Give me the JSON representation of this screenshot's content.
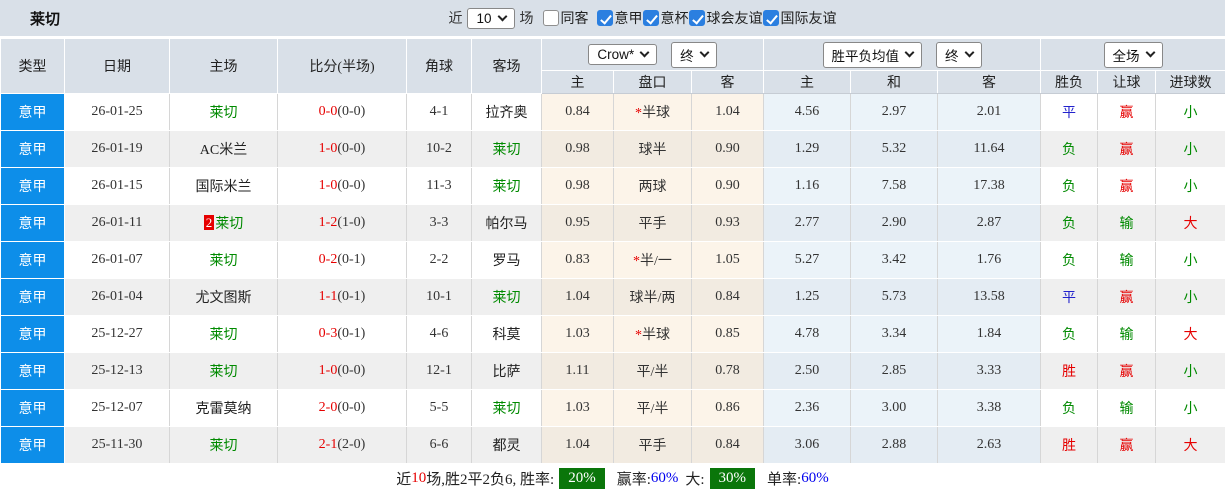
{
  "title": "莱切",
  "topbar": {
    "near_label": "近",
    "matches_value": "10",
    "matches_label": "场",
    "checkboxes": [
      {
        "id": "same-away",
        "label": "同客",
        "checked": false
      },
      {
        "id": "serie-a",
        "label": "意甲",
        "checked": true
      },
      {
        "id": "italy-cup",
        "label": "意杯",
        "checked": true
      },
      {
        "id": "club-friendly",
        "label": "球会友谊",
        "checked": true
      },
      {
        "id": "intl-friendly",
        "label": "国际友谊",
        "checked": true
      }
    ]
  },
  "header": {
    "left_cols": [
      "类型",
      "日期",
      "主场",
      "比分(半场)",
      "角球",
      "客场"
    ],
    "odds_group": {
      "company_select": "Crow*",
      "stage_select": "终",
      "cols": [
        "主",
        "盘口",
        "客"
      ]
    },
    "mean_group": {
      "type_select": "胜平负均值",
      "stage_select": "终",
      "cols": [
        "主",
        "和",
        "客"
      ]
    },
    "result_group": {
      "scope_select": "全场",
      "cols": [
        "胜负",
        "让球",
        "进球数"
      ]
    }
  },
  "rows": [
    {
      "league": "意甲",
      "date": "26-01-25",
      "home": "莱切",
      "home_c": "green",
      "home_badge": "",
      "score": "0-0",
      "half": "(0-0)",
      "corner": "4-1",
      "away": "拉齐奥",
      "away_c": "dark",
      "o_home": "0.84",
      "star": "*",
      "handicap": "半球",
      "o_away": "1.04",
      "m_home": "4.56",
      "m_draw": "2.97",
      "m_away": "2.01",
      "result": {
        "t": "平",
        "c": "blue"
      },
      "hresult": {
        "t": "赢",
        "c": "red"
      },
      "goals": {
        "t": "小",
        "c": "green"
      }
    },
    {
      "league": "意甲",
      "date": "26-01-19",
      "home": "AC米兰",
      "home_c": "dark",
      "home_badge": "",
      "score": "1-0",
      "half": "(0-0)",
      "corner": "10-2",
      "away": "莱切",
      "away_c": "green",
      "o_home": "0.98",
      "star": "",
      "handicap": "球半",
      "o_away": "0.90",
      "m_home": "1.29",
      "m_draw": "5.32",
      "m_away": "11.64",
      "result": {
        "t": "负",
        "c": "green"
      },
      "hresult": {
        "t": "赢",
        "c": "red"
      },
      "goals": {
        "t": "小",
        "c": "green"
      }
    },
    {
      "league": "意甲",
      "date": "26-01-15",
      "home": "国际米兰",
      "home_c": "dark",
      "home_badge": "",
      "score": "1-0",
      "half": "(0-0)",
      "corner": "11-3",
      "away": "莱切",
      "away_c": "green",
      "o_home": "0.98",
      "star": "",
      "handicap": "两球",
      "o_away": "0.90",
      "m_home": "1.16",
      "m_draw": "7.58",
      "m_away": "17.38",
      "result": {
        "t": "负",
        "c": "green"
      },
      "hresult": {
        "t": "赢",
        "c": "red"
      },
      "goals": {
        "t": "小",
        "c": "green"
      }
    },
    {
      "league": "意甲",
      "date": "26-01-11",
      "home": "莱切",
      "home_c": "green",
      "home_badge": "2",
      "score": "1-2",
      "half": "(1-0)",
      "corner": "3-3",
      "away": "帕尔马",
      "away_c": "dark",
      "o_home": "0.95",
      "star": "",
      "handicap": "平手",
      "o_away": "0.93",
      "m_home": "2.77",
      "m_draw": "2.90",
      "m_away": "2.87",
      "result": {
        "t": "负",
        "c": "green"
      },
      "hresult": {
        "t": "输",
        "c": "green"
      },
      "goals": {
        "t": "大",
        "c": "red"
      }
    },
    {
      "league": "意甲",
      "date": "26-01-07",
      "home": "莱切",
      "home_c": "green",
      "home_badge": "",
      "score": "0-2",
      "half": "(0-1)",
      "corner": "2-2",
      "away": "罗马",
      "away_c": "dark",
      "o_home": "0.83",
      "star": "*",
      "handicap": "半/一",
      "o_away": "1.05",
      "m_home": "5.27",
      "m_draw": "3.42",
      "m_away": "1.76",
      "result": {
        "t": "负",
        "c": "green"
      },
      "hresult": {
        "t": "输",
        "c": "green"
      },
      "goals": {
        "t": "小",
        "c": "green"
      }
    },
    {
      "league": "意甲",
      "date": "26-01-04",
      "home": "尤文图斯",
      "home_c": "dark",
      "home_badge": "",
      "score": "1-1",
      "half": "(0-1)",
      "corner": "10-1",
      "away": "莱切",
      "away_c": "green",
      "o_home": "1.04",
      "star": "",
      "handicap": "球半/两",
      "o_away": "0.84",
      "m_home": "1.25",
      "m_draw": "5.73",
      "m_away": "13.58",
      "result": {
        "t": "平",
        "c": "blue"
      },
      "hresult": {
        "t": "赢",
        "c": "red"
      },
      "goals": {
        "t": "小",
        "c": "green"
      }
    },
    {
      "league": "意甲",
      "date": "25-12-27",
      "home": "莱切",
      "home_c": "green",
      "home_badge": "",
      "score": "0-3",
      "half": "(0-1)",
      "corner": "4-6",
      "away": "科莫",
      "away_c": "dark",
      "o_home": "1.03",
      "star": "*",
      "handicap": "半球",
      "o_away": "0.85",
      "m_home": "4.78",
      "m_draw": "3.34",
      "m_away": "1.84",
      "result": {
        "t": "负",
        "c": "green"
      },
      "hresult": {
        "t": "输",
        "c": "green"
      },
      "goals": {
        "t": "大",
        "c": "red"
      }
    },
    {
      "league": "意甲",
      "date": "25-12-13",
      "home": "莱切",
      "home_c": "green",
      "home_badge": "",
      "score": "1-0",
      "half": "(0-0)",
      "corner": "12-1",
      "away": "比萨",
      "away_c": "dark",
      "o_home": "1.11",
      "star": "",
      "handicap": "平/半",
      "o_away": "0.78",
      "m_home": "2.50",
      "m_draw": "2.85",
      "m_away": "3.33",
      "result": {
        "t": "胜",
        "c": "red"
      },
      "hresult": {
        "t": "赢",
        "c": "red"
      },
      "goals": {
        "t": "小",
        "c": "green"
      }
    },
    {
      "league": "意甲",
      "date": "25-12-07",
      "home": "克雷莫纳",
      "home_c": "dark",
      "home_badge": "",
      "score": "2-0",
      "half": "(0-0)",
      "corner": "5-5",
      "away": "莱切",
      "away_c": "green",
      "o_home": "1.03",
      "star": "",
      "handicap": "平/半",
      "o_away": "0.86",
      "m_home": "2.36",
      "m_draw": "3.00",
      "m_away": "3.38",
      "result": {
        "t": "负",
        "c": "green"
      },
      "hresult": {
        "t": "输",
        "c": "green"
      },
      "goals": {
        "t": "小",
        "c": "green"
      }
    },
    {
      "league": "意甲",
      "date": "25-11-30",
      "home": "莱切",
      "home_c": "green",
      "home_badge": "",
      "score": "2-1",
      "half": "(2-0)",
      "corner": "6-6",
      "away": "都灵",
      "away_c": "dark",
      "o_home": "1.04",
      "star": "",
      "handicap": "平手",
      "o_away": "0.84",
      "m_home": "3.06",
      "m_draw": "2.88",
      "m_away": "2.63",
      "result": {
        "t": "胜",
        "c": "red"
      },
      "hresult": {
        "t": "赢",
        "c": "red"
      },
      "goals": {
        "t": "大",
        "c": "red"
      }
    }
  ],
  "footer": {
    "part1": "近",
    "count": "10",
    "part2": "场,胜2平2负6, 胜率:",
    "win_rate": "20%",
    "label_win": "赢率:",
    "win_pct": "60%",
    "label_big": "大:",
    "big_rate": "30%",
    "label_single": "单率:",
    "single_pct": "60%"
  },
  "colors": {
    "league_blue": "#0d8ee9",
    "red": "#e60000",
    "green": "#008a00",
    "blue": "#2222cc",
    "badge_green": "#0a760a",
    "checkbox_blue": "#2b7fe0",
    "header_bg": "#d9e0e8"
  }
}
